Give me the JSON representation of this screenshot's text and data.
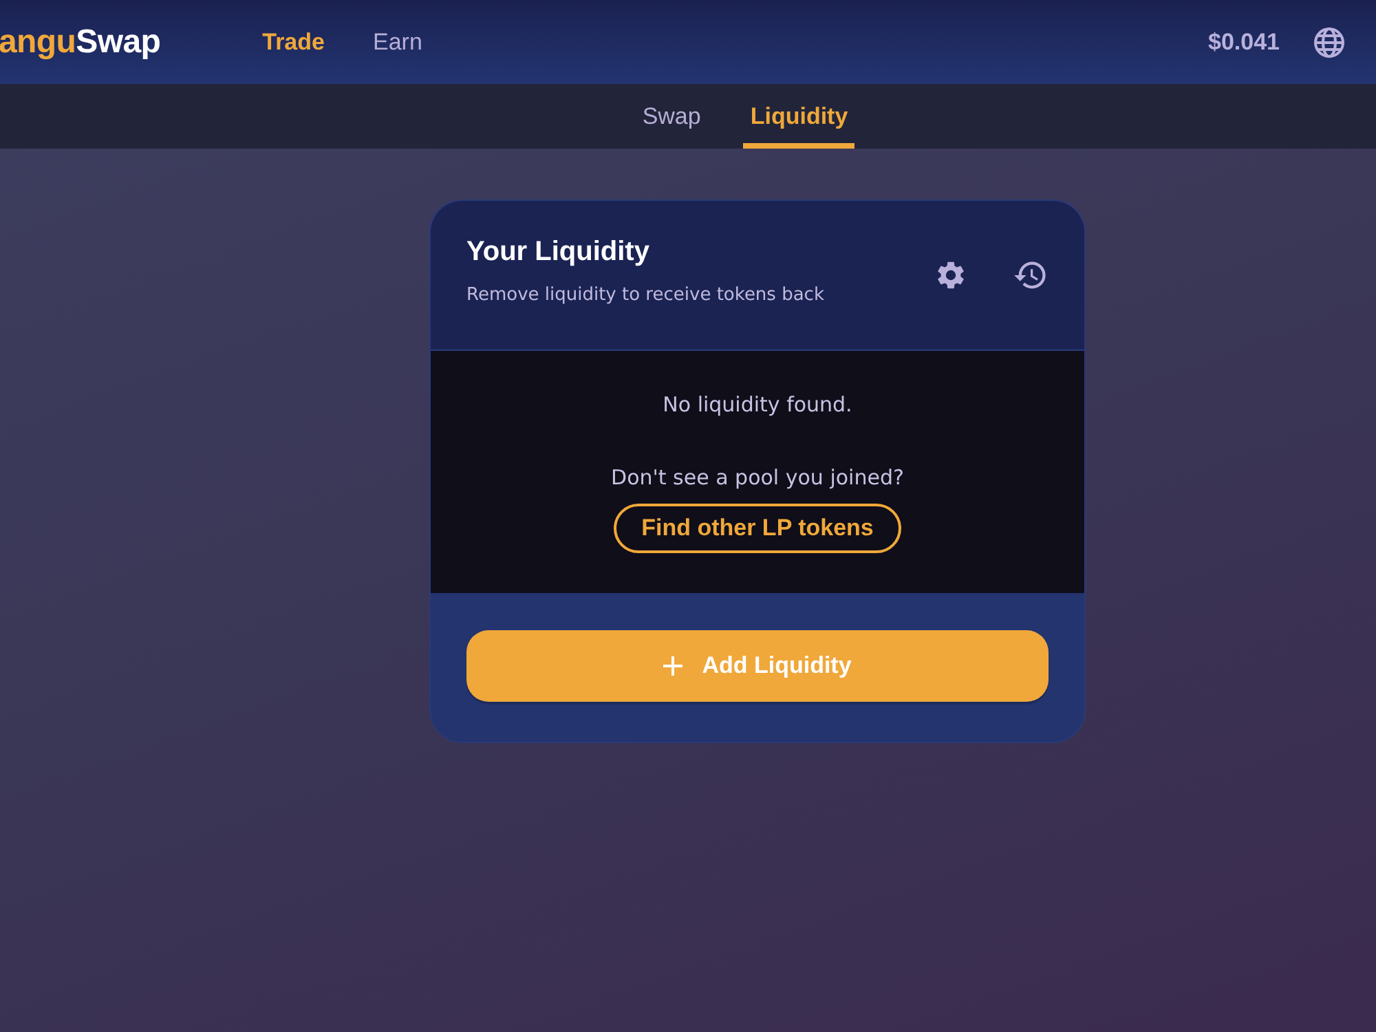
{
  "header": {
    "logo": {
      "highlight": "angu",
      "rest": "Swap"
    },
    "nav": [
      {
        "label": "Trade",
        "selected": true
      },
      {
        "label": "Earn",
        "selected": false
      }
    ],
    "price": "$0.041"
  },
  "subnav": {
    "tabs": [
      {
        "label": "Swap",
        "selected": false
      },
      {
        "label": "Liquidity",
        "selected": true
      }
    ]
  },
  "card": {
    "title": "Your Liquidity",
    "subtitle": "Remove liquidity to receive tokens back",
    "empty_message": "No liquidity found.",
    "prompt": "Don't see a pool you joined?",
    "find_button": "Find other LP tokens",
    "add_button": "Add Liquidity"
  }
}
